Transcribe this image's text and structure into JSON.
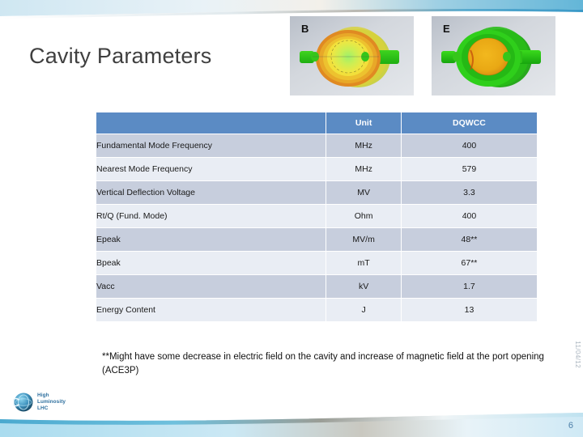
{
  "slide": {
    "title": "Cavity Parameters",
    "page_number": "6",
    "date": "11/04/12"
  },
  "figures": [
    {
      "label": "B",
      "name": "magnetic-field-plot"
    },
    {
      "label": "E",
      "name": "electric-field-plot"
    }
  ],
  "table": {
    "headers": [
      "",
      "Unit",
      "DQWCC"
    ],
    "rows": [
      {
        "name": "Fundamental Mode Frequency",
        "unit": "MHz",
        "value": "400"
      },
      {
        "name": "Nearest Mode Frequency",
        "unit": "MHz",
        "value": "579"
      },
      {
        "name": "Vertical Deflection Voltage",
        "unit": "MV",
        "value": "3.3"
      },
      {
        "name": "Rt/Q (Fund. Mode)",
        "unit": "Ohm",
        "value": "400"
      },
      {
        "name": "Epeak",
        "unit": "MV/m",
        "value": "48**"
      },
      {
        "name": "Bpeak",
        "unit": "mT",
        "value": "67**"
      },
      {
        "name": "Vacc",
        "unit": "kV",
        "value": "1.7"
      },
      {
        "name": "Energy Content",
        "unit": "J",
        "value": "13"
      }
    ]
  },
  "footnote": "**Might have some decrease in electric field on the cavity and increase of magnetic field at the port opening (ACE3P)",
  "logo": {
    "line1": "High",
    "line2": "Luminosity",
    "line3": "LHC"
  },
  "colors": {
    "table_header": "#5b8bc4",
    "band_dark": "#c7cedd",
    "band_light": "#e9edf4",
    "accent_blue": "#7fc4e0",
    "title_text": "#3f3f3f"
  }
}
